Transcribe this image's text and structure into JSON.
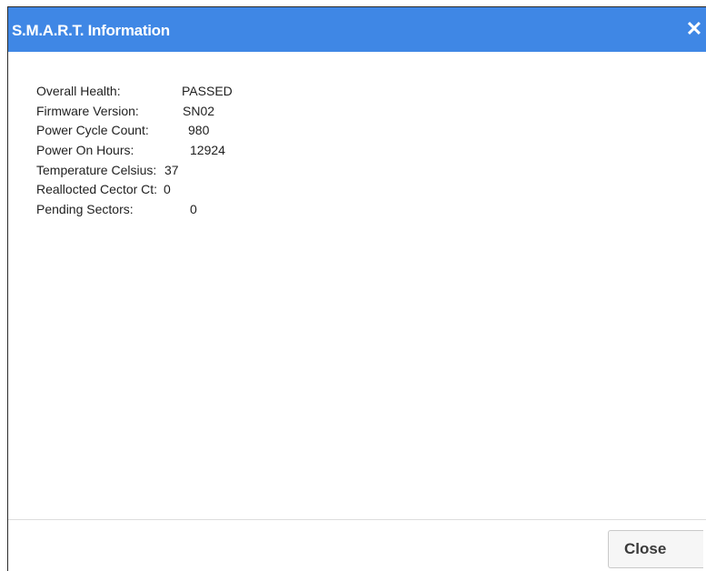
{
  "dialog": {
    "title": "S.M.A.R.T. Information",
    "close_icon": "close-icon",
    "close_glyph": "✕"
  },
  "smart_info": [
    {
      "label": "Overall Health:",
      "value": "PASSED"
    },
    {
      "label": "Firmware Version:",
      "value": "SN02"
    },
    {
      "label": "Power Cycle Count:",
      "value": "980"
    },
    {
      "label": "Power On Hours:",
      "value": "12924"
    },
    {
      "label": "Temperature Celsius:",
      "value": "37"
    },
    {
      "label": "Reallocted Cector Ct:",
      "value": "0"
    },
    {
      "label": "Pending Sectors:",
      "value": "0"
    }
  ],
  "footer": {
    "close_label": "Close"
  },
  "colors": {
    "titlebar": "#3f87e5",
    "title_text": "#ffffff",
    "body_text": "#1f1f1f",
    "button_bg": "#f6f6f6"
  }
}
